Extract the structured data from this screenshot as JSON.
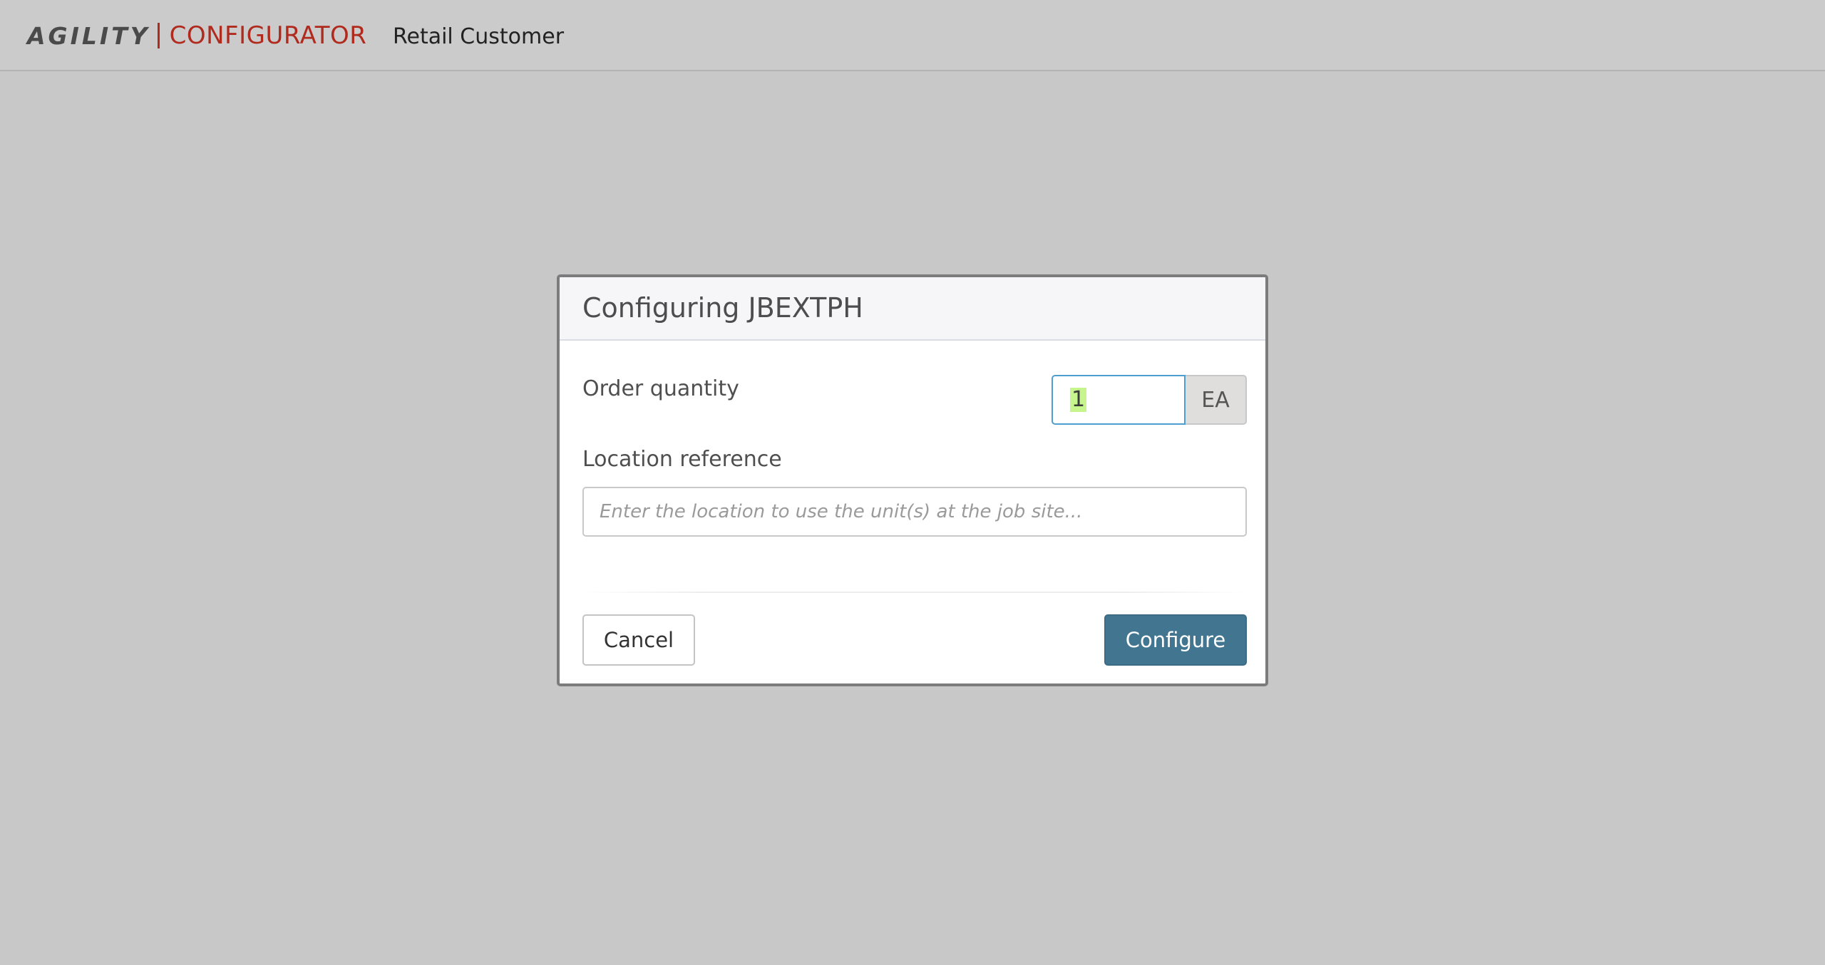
{
  "header": {
    "logo_brand": "AGILITY",
    "logo_product": "CONFIGURATOR",
    "customer": "Retail Customer"
  },
  "dialog": {
    "title": "Configuring JBEXTPH",
    "order_quantity_label": "Order quantity",
    "order_quantity_value": "1",
    "order_quantity_unit": "EA",
    "location_label": "Location reference",
    "location_placeholder": "Enter the location to use the unit(s) at the job site...",
    "location_value": "",
    "cancel_label": "Cancel",
    "configure_label": "Configure"
  },
  "colors": {
    "brand_red": "#b02a1e",
    "primary_button": "#42758f",
    "overlay_background": "#c8c8c8",
    "focus_border": "#4d9fcf"
  }
}
